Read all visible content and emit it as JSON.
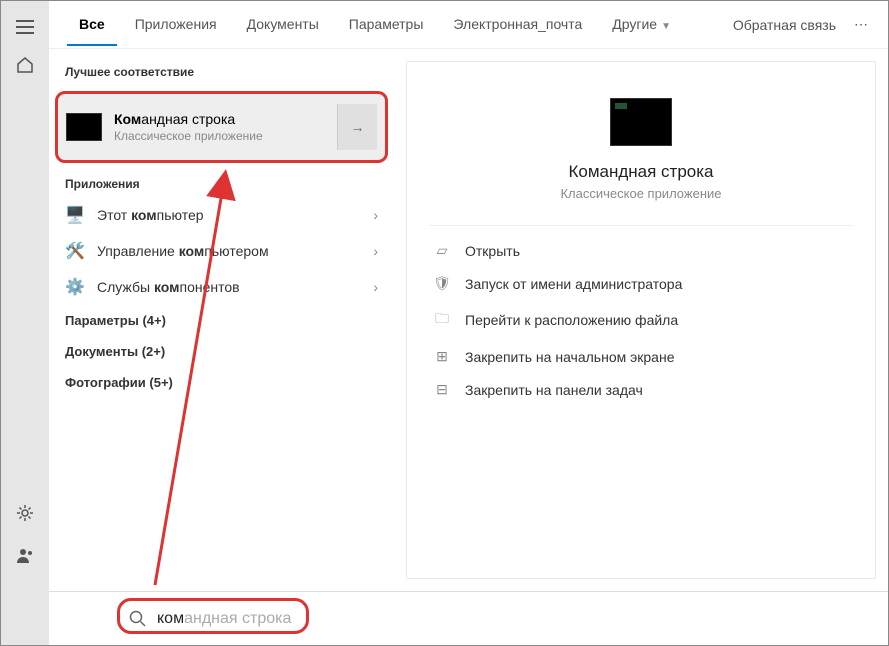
{
  "tabs": {
    "all": "Все",
    "apps": "Приложения",
    "docs": "Документы",
    "settings": "Параметры",
    "email": "Электронная_почта",
    "more": "Другие"
  },
  "feedback": "Обратная связь",
  "labels": {
    "best_match": "Лучшее соответствие",
    "apps_section": "Приложения"
  },
  "best": {
    "title_prefix": "Ком",
    "title_rest": "андная строка",
    "subtitle": "Классическое приложение"
  },
  "results": {
    "apps": [
      {
        "icon": "🖥️",
        "pre": "Этот ",
        "hl": "ком",
        "post": "пьютер"
      },
      {
        "icon": "🛠️",
        "pre": "Управление ",
        "hl": "ком",
        "post": "пьютером"
      },
      {
        "icon": "⚙️",
        "pre": "Службы ",
        "hl": "ком",
        "post": "понентов"
      }
    ],
    "categories": [
      "Параметры (4+)",
      "Документы (2+)",
      "Фотографии (5+)"
    ]
  },
  "preview": {
    "title": "Командная строка",
    "subtitle": "Классическое приложение",
    "actions": [
      "Открыть",
      "Запуск от имени администратора",
      "Перейти к расположению файла",
      "Закрепить на начальном экране",
      "Закрепить на панели задач"
    ]
  },
  "search": {
    "typed": "ком",
    "ghost": "андная строка"
  }
}
